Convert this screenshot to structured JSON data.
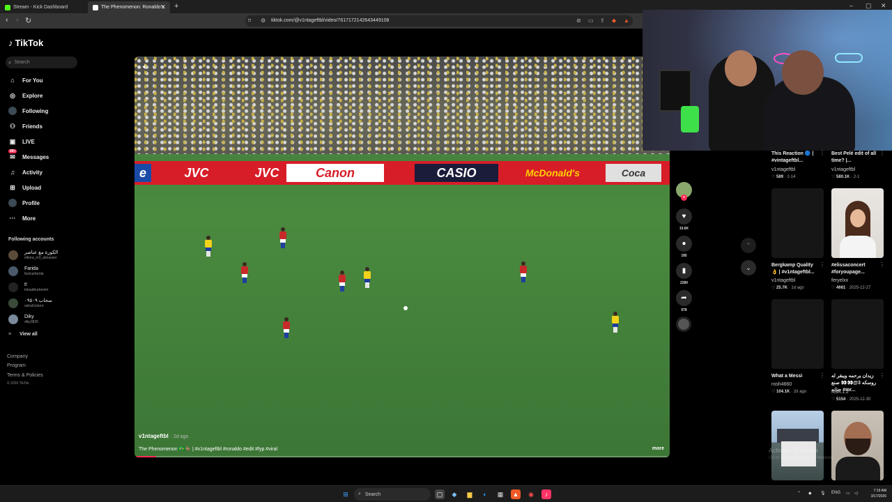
{
  "browser": {
    "tabs": [
      {
        "title": "Stream - Kick Dashboard",
        "favicon_color": "#53fc18"
      },
      {
        "title": "The Phenomenon: Ronaldo's",
        "favicon_color": "#ffffff"
      }
    ],
    "url": "tiktok.com/@v1ntageftbl/video/7617172142643449108",
    "new_tab": "+",
    "window_controls": [
      "–",
      "▢",
      "✕"
    ]
  },
  "sidebar": {
    "logo": "TikTok",
    "search_placeholder": "Search",
    "nav": [
      {
        "label": "For You",
        "icon": "home-icon"
      },
      {
        "label": "Explore",
        "icon": "compass-icon"
      },
      {
        "label": "Following",
        "icon": "following-icon"
      },
      {
        "label": "Friends",
        "icon": "friends-icon"
      },
      {
        "label": "LIVE",
        "icon": "live-icon"
      },
      {
        "label": "Messages",
        "icon": "message-icon",
        "badge": "99+"
      },
      {
        "label": "Activity",
        "icon": "bell-icon"
      },
      {
        "label": "Upload",
        "icon": "plus-icon"
      },
      {
        "label": "Profile",
        "icon": "profile-icon"
      },
      {
        "label": "More",
        "icon": "more-icon"
      }
    ],
    "following_title": "Following accounts",
    "accounts": [
      {
        "name": "الكورة مع عناصر",
        "handle": "elkora_m3_abnasser",
        "color": "#5a4a3a"
      },
      {
        "name": "Farida",
        "handle": "fastcarfarida",
        "color": "#4a5a6a"
      },
      {
        "name": "t!",
        "handle": "tokaalbrahemm",
        "color": "#222222"
      },
      {
        "name": "سحاب ٠٩٥٠٩",
        "handle": "sahab1store",
        "color": "#3a4a3a"
      },
      {
        "name": "Diky",
        "handle": "diky3825",
        "color": "#7a8a9a"
      }
    ],
    "view_all": "View all",
    "footer": [
      "Company",
      "Program",
      "Terms & Policies"
    ],
    "copyright": "© 2026 TikTok"
  },
  "video": {
    "author": "v1ntageftbl",
    "posted": "· 2d ago",
    "caption": "The Phenomenon 🇧🇷🐐 | #v1ntageftbl #ronaldo #edit #fyp #viral",
    "more": "more",
    "progress_percent": 4,
    "ads": [
      "e",
      "JVC",
      "JVC",
      "Canon",
      "CASIO",
      "McDonald's",
      "Coca"
    ]
  },
  "actions": {
    "likes": "19.6K",
    "comments": "185",
    "saves": "2280",
    "shares": "978"
  },
  "recommendations": [
    {
      "title": "This Reaction 🔵 | #vintageftbl...",
      "user": "v1ntageftbl",
      "views": "589",
      "date": "2-14",
      "thumb": "dark"
    },
    {
      "title": "Best Pelé edit of all time? |...",
      "user": "v1ntageftbl",
      "views": "580.1K",
      "date": "2-1",
      "thumb": "dark"
    },
    {
      "title": "Bergkamp Quality 👌 | #v1ntageftbl...",
      "user": "v1ntageftbl",
      "views": "25.7K",
      "date": "1d ago",
      "thumb": "dark"
    },
    {
      "title": "#elissaconcert #foryoupage...",
      "user": "feryelxx",
      "views": "4661",
      "date": "2025-12-27",
      "thumb": "girl"
    },
    {
      "title": "What a Messi",
      "user": "rosh4660",
      "views": "104.1K",
      "date": "2d ago",
      "thumb": "dark"
    },
    {
      "title": "زيدان يرحمه ويبقر له روسكه 3@👀👀 صنع جنانه #mr...",
      "user": "fosh.1.2",
      "views": "5154",
      "date": "2025-12-30",
      "thumb": "dark"
    },
    {
      "title": "",
      "user": "",
      "views": "",
      "date": "",
      "thumb": "house"
    },
    {
      "title": "",
      "user": "",
      "views": "",
      "date": "",
      "thumb": "man"
    }
  ],
  "watermark": {
    "line1": "Activate Windows",
    "line2": "Go to Settings to activate Windows."
  },
  "taskbar": {
    "search": "Search",
    "lang": "ENG",
    "time": "7:19 AM",
    "date": "3/17/2026"
  }
}
